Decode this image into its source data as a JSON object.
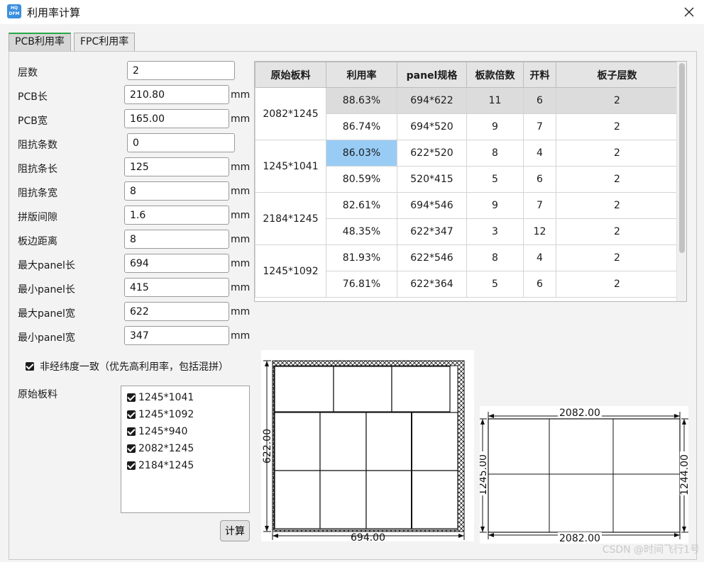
{
  "window": {
    "title": "利用率计算",
    "logo_top": "HQ",
    "logo_bottom": "DFM"
  },
  "tabs": [
    {
      "label": "PCB利用率",
      "active": true
    },
    {
      "label": "FPC利用率",
      "active": false
    }
  ],
  "form": {
    "layers": {
      "label": "层数",
      "value": "2"
    },
    "pcb_length": {
      "label": "PCB长",
      "value": "210.80",
      "unit": "mm"
    },
    "pcb_width": {
      "label": "PCB宽",
      "value": "165.00",
      "unit": "mm"
    },
    "impedance_count": {
      "label": "阻抗条数",
      "value": "0"
    },
    "impedance_length": {
      "label": "阻抗条长",
      "value": "125",
      "unit": "mm"
    },
    "impedance_width": {
      "label": "阻抗条宽",
      "value": "8",
      "unit": "mm"
    },
    "panel_gap": {
      "label": "拼版间隙",
      "value": "1.6",
      "unit": "mm"
    },
    "edge_distance": {
      "label": "板边距离",
      "value": "8",
      "unit": "mm"
    },
    "max_panel_length": {
      "label": "最大panel长",
      "value": "694",
      "unit": "mm"
    },
    "min_panel_length": {
      "label": "最小panel长",
      "value": "415",
      "unit": "mm"
    },
    "max_panel_width": {
      "label": "最大panel宽",
      "value": "622",
      "unit": "mm"
    },
    "min_panel_width": {
      "label": "最小panel宽",
      "value": "347",
      "unit": "mm"
    },
    "grain_option": {
      "label": "非经纬度一致（优先高利用率，包括混拼）",
      "checked": true
    },
    "raw_material_label": "原始板料",
    "raw_materials": [
      {
        "label": "1245*1041",
        "checked": true
      },
      {
        "label": "1245*1092",
        "checked": true
      },
      {
        "label": "1245*940",
        "checked": true
      },
      {
        "label": "2082*1245",
        "checked": true
      },
      {
        "label": "2184*1245",
        "checked": true
      }
    ],
    "calc_button": "计算"
  },
  "table": {
    "headers": [
      "原始板料",
      "利用率",
      "panel规格",
      "板款倍数",
      "开料",
      "板子层数"
    ],
    "groups": [
      {
        "material": "2082*1245",
        "rows": [
          [
            "88.63%",
            "694*622",
            "11",
            "6",
            "2"
          ],
          [
            "86.74%",
            "694*520",
            "9",
            "7",
            "2"
          ]
        ]
      },
      {
        "material": "1245*1041",
        "rows": [
          [
            "86.03%",
            "622*520",
            "8",
            "4",
            "2"
          ],
          [
            "80.59%",
            "520*415",
            "5",
            "6",
            "2"
          ]
        ]
      },
      {
        "material": "2184*1245",
        "rows": [
          [
            "82.61%",
            "694*546",
            "9",
            "7",
            "2"
          ],
          [
            "48.35%",
            "622*347",
            "3",
            "12",
            "2"
          ]
        ]
      },
      {
        "material": "1245*1092",
        "rows": [
          [
            "81.93%",
            "622*546",
            "8",
            "4",
            "2"
          ],
          [
            "76.81%",
            "622*364",
            "5",
            "6",
            "2"
          ]
        ]
      }
    ],
    "highlighted_row": 0,
    "selected_cell": "86.03%",
    "selection_color": "#99ccf5"
  },
  "panel_diagram": {
    "width_label": "694.00",
    "height_label": "622.00"
  },
  "material_diagram": {
    "top_label": "2082.00",
    "bottom_label": "2082.00",
    "left_label": "1245.00",
    "right_label": "1244.00"
  },
  "watermark": "CSDN @时间飞行1号"
}
